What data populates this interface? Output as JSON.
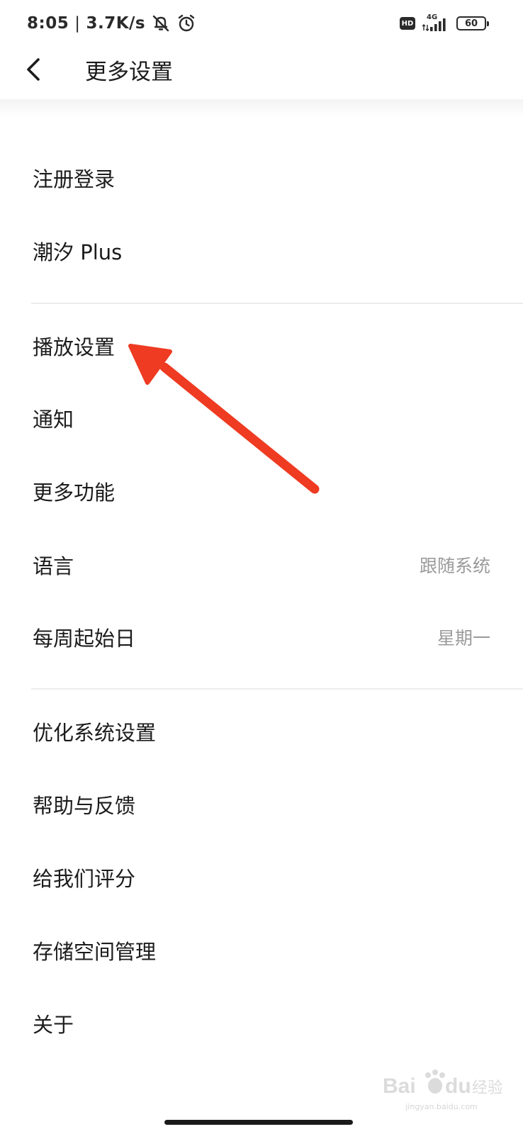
{
  "status_bar": {
    "time": "8:05",
    "separator": "|",
    "net_speed": "3.7K/s",
    "hd_label": "HD",
    "network_type": "4G",
    "battery_level": "60"
  },
  "header": {
    "title": "更多设置"
  },
  "settings": {
    "group1": [
      {
        "label": "注册登录"
      },
      {
        "label": "潮汐 Plus"
      }
    ],
    "group2": [
      {
        "label": "播放设置"
      },
      {
        "label": "通知"
      },
      {
        "label": "更多功能"
      },
      {
        "label": "语言",
        "value": "跟随系统"
      },
      {
        "label": "每周起始日",
        "value": "星期一"
      }
    ],
    "group3": [
      {
        "label": "优化系统设置"
      },
      {
        "label": "帮助与反馈"
      },
      {
        "label": "给我们评分"
      },
      {
        "label": "存储空间管理"
      },
      {
        "label": "关于"
      }
    ]
  },
  "watermark": {
    "brand": "Bai du 经验",
    "url": "jingyan.baidu.com"
  },
  "colors": {
    "text_primary": "#1c1c1c",
    "text_secondary": "#9a9a9a",
    "divider": "#ececec",
    "annotation_arrow": "#ee3b22"
  },
  "icons": {
    "back": "chevron-left-icon",
    "mute": "bell-off-icon",
    "alarm": "alarm-clock-icon",
    "signal": "signal-bars-icon",
    "battery": "battery-icon"
  }
}
